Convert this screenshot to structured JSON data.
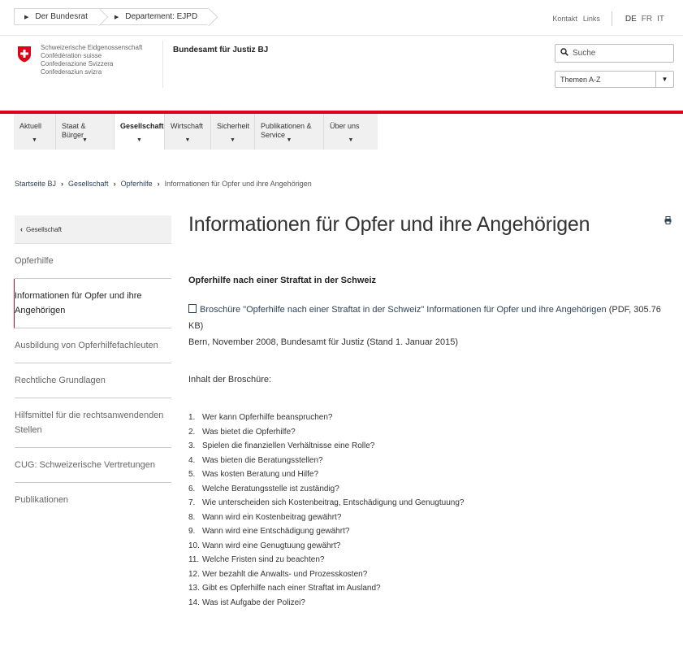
{
  "topbar": {
    "crumbs": [
      "Der Bundesrat",
      "Departement: EJPD"
    ],
    "links": [
      "Kontakt",
      "Links"
    ],
    "languages": [
      "DE",
      "FR",
      "IT"
    ],
    "active_language": "DE"
  },
  "header": {
    "org_lines": [
      "Schweizerische Eidgenossenschaft",
      "Confédération suisse",
      "Confederazione Svizzera",
      "Confederaziun svizra"
    ],
    "office": "Bundesamt für Justiz BJ",
    "search_placeholder": "Suche",
    "themen_label": "Themen A-Z"
  },
  "nav": {
    "items": [
      {
        "label": "Aktuell"
      },
      {
        "label": "Staat & Bürger"
      },
      {
        "label": "Gesellschaft",
        "active": true
      },
      {
        "label": "Wirtschaft"
      },
      {
        "label": "Sicherheit"
      },
      {
        "label": "Publikationen & Service"
      },
      {
        "label": "Über uns"
      }
    ]
  },
  "breadcrumb": {
    "items": [
      "Startseite BJ",
      "Gesellschaft",
      "Opferhilfe",
      "Informationen für Opfer und ihre Angehörigen"
    ]
  },
  "sidebar": {
    "back_label": "Gesellschaft",
    "items": [
      {
        "label": "Opferhilfe"
      },
      {
        "label": "Informationen für Opfer und ihre Angehörigen",
        "active": true
      },
      {
        "label": "Ausbildung von Opferhilfefachleuten"
      },
      {
        "label": "Rechtliche Grundlagen"
      },
      {
        "label": "Hilfsmittel für die rechtsanwendenden Stellen"
      },
      {
        "label": "CUG: Schweizerische Vertretungen"
      },
      {
        "label": "Publikationen"
      }
    ]
  },
  "main": {
    "title": "Informationen für Opfer und ihre Angehörigen",
    "subtitle": "Opferhilfe nach einer Straftat in der Schweiz",
    "doc_link": "Broschüre \"Opferhilfe nach einer Straftat in der Schweiz\" Informationen für Opfer und ihre Angehörigen",
    "doc_meta": "(PDF, 305.76 KB)",
    "bern": "Bern, November 2008, Bundesamt für Justiz (Stand 1. Januar 2015)",
    "inhalt": "Inhalt der Broschüre:",
    "toc": [
      "Wer kann Opferhilfe beanspruchen?",
      "Was bietet die Opferhilfe?",
      "Spielen die finanziellen Verhältnisse eine Rolle?",
      "Was bieten die Beratungsstellen?",
      "Was kosten Beratung und Hilfe?",
      "Welche Beratungsstelle ist zuständig?",
      "Wie unterscheiden sich Kostenbeitrag, Entschädigung und Genugtuung?",
      "Wann wird ein Kostenbeitrag gewährt?",
      "Wann wird eine Entschädigung gewährt?",
      "Wann wird eine Genugtuung gewährt?",
      "Welche Fristen sind zu beachten?",
      "Wer bezahlt die Anwalts- und Prozesskosten?",
      "Gibt es Opferhilfe nach einer Straftat im Ausland?",
      "Was ist Aufgabe der Polizei?"
    ]
  },
  "colors": {
    "accent_red": "#dc0018",
    "link_blue": "#2f4356",
    "nav_bg": "#f0f0f0"
  }
}
